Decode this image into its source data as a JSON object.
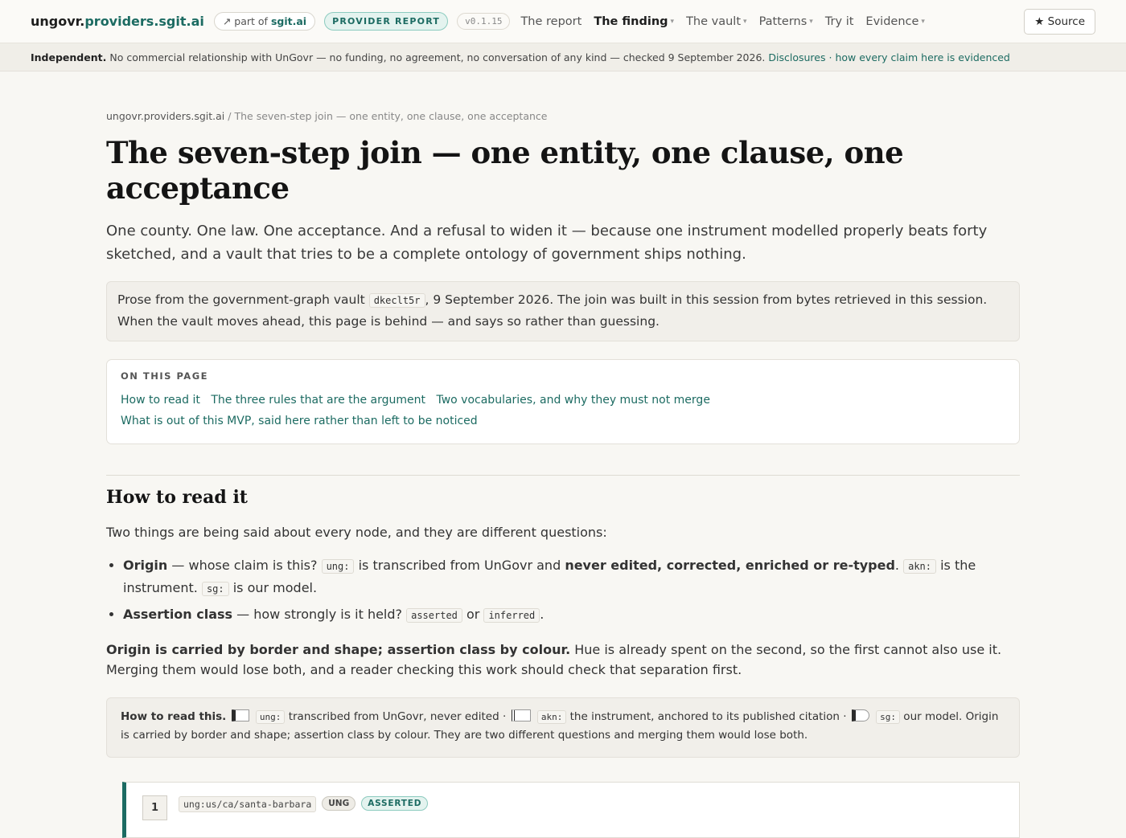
{
  "topbar": {
    "brand_plain": "ungovr.",
    "brand_accent": "providers.sgit.ai",
    "part_prefix": "↗ part of",
    "part_link": "sgit.ai",
    "report_badge": "PROVIDER REPORT",
    "version": "v0.1.15",
    "nav": [
      {
        "label": "The report",
        "caret": ""
      },
      {
        "label": "The finding",
        "caret": "▾"
      },
      {
        "label": "The vault",
        "caret": "▾"
      },
      {
        "label": "Patterns",
        "caret": "▾"
      },
      {
        "label": "Try it",
        "caret": ""
      },
      {
        "label": "Evidence",
        "caret": "▾"
      }
    ],
    "source_label": "★ Source"
  },
  "notice": {
    "lead": "Independent.",
    "text": "No commercial relationship with UnGovr — no funding, no agreement, no conversation of any kind — checked 9 September 2026.",
    "link1": "Disclosures",
    "sep": "·",
    "link2": "how every claim here is evidenced"
  },
  "breadcrumb": {
    "root": "ungovr.providers.sgit.ai",
    "sep": " / ",
    "current": "The seven-step join — one entity, one clause, one acceptance"
  },
  "page": {
    "title": "The seven-step join — one entity, one clause, one acceptance",
    "lede": "One county. One law. One acceptance. And a refusal to widen it — because one instrument modelled properly beats forty sketched, and a vault that tries to be a complete ontology of government ships nothing."
  },
  "infobox": {
    "pre": "Prose from the government-graph vault",
    "code": "dkeclt5r",
    "post": ", 9 September 2026. The join was built in this session from bytes retrieved in this session. When the vault moves ahead, this page is behind — and says so rather than guessing."
  },
  "toc": {
    "title": "ON THIS PAGE",
    "links": [
      "How to read it",
      "The three rules that are the argument",
      "Two vocabularies, and why they must not merge",
      "What is out of this MVP, said here rather than left to be noticed"
    ]
  },
  "section": {
    "heading": "How to read it",
    "intro": "Two things are being said about every node, and they are different questions:",
    "origin": {
      "term": "Origin",
      "q": " — whose claim is this? ",
      "c1": "ung:",
      "t1": " is transcribed from UnGovr and ",
      "strong": "never edited, corrected, enriched or re-typed",
      "t2": ". ",
      "c2": "akn:",
      "t3": " is the instrument. ",
      "c3": "sg:",
      "t4": " is our model."
    },
    "assertion": {
      "term": "Assertion class",
      "q": " — how strongly is it held? ",
      "c1": "asserted",
      "or": " or ",
      "c2": "inferred",
      "end": "."
    },
    "rule_strong": "Origin is carried by border and shape; assertion class by colour.",
    "rule_rest": " Hue is already spent on the second, so the first cannot also use it. Merging them would lose both, and a reader checking this work should check that separation first."
  },
  "legend": {
    "title": "How to read this.",
    "ung_code": "ung:",
    "ung_text": " transcribed from UnGovr, never edited · ",
    "akn_code": "akn:",
    "akn_text": " the instrument, anchored to its published citation · ",
    "sg_code": "sg:",
    "sg_text": " our model. Origin is carried by border and shape; assertion class by colour. They are two different questions and merging them would lose both."
  },
  "node": {
    "number": "1",
    "iri": "ung:us/ca/santa-barbara",
    "origin_badge": "UNG",
    "class_badge": "ASSERTED"
  }
}
